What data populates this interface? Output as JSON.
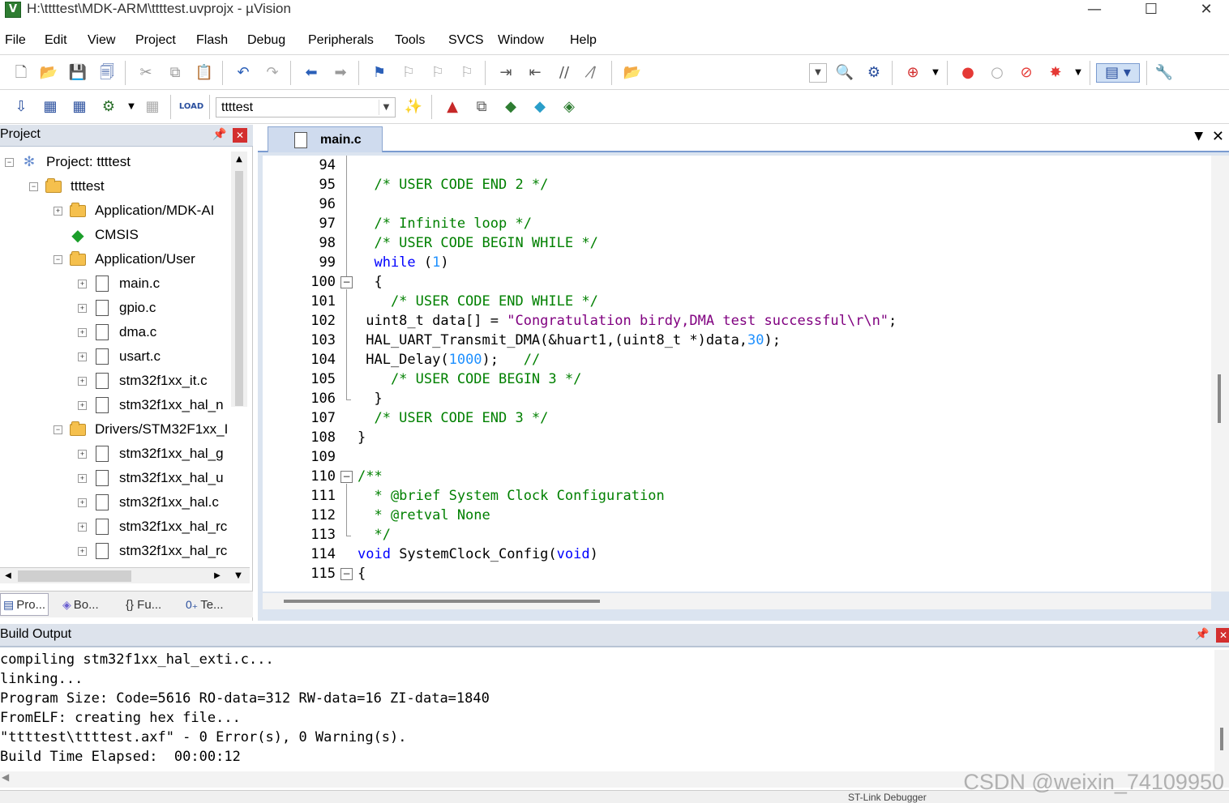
{
  "window": {
    "title": "H:\\ttttest\\MDK-ARM\\ttttest.uvprojx - µVision",
    "minimize": "—",
    "maximize": "☐",
    "close": "✕"
  },
  "menu": [
    "File",
    "Edit",
    "View",
    "Project",
    "Flash",
    "Debug",
    "Peripherals",
    "Tools",
    "SVCS",
    "Window",
    "Help"
  ],
  "toolbar2": {
    "target_name": "ttttest"
  },
  "project_panel": {
    "title": "Project",
    "tree": [
      {
        "label": "Project: ttttest",
        "kind": "project",
        "toggle": "−"
      },
      {
        "label": "ttttest",
        "kind": "target",
        "toggle": "−"
      },
      {
        "label": "Application/MDK-AI",
        "kind": "folder",
        "toggle": "+"
      },
      {
        "label": "CMSIS",
        "kind": "cmsis",
        "toggle": ""
      },
      {
        "label": "Application/User",
        "kind": "folder-open",
        "toggle": "−"
      },
      {
        "label": "main.c",
        "kind": "file",
        "toggle": "+"
      },
      {
        "label": "gpio.c",
        "kind": "file",
        "toggle": "+"
      },
      {
        "label": "dma.c",
        "kind": "file",
        "toggle": "+"
      },
      {
        "label": "usart.c",
        "kind": "file",
        "toggle": "+"
      },
      {
        "label": "stm32f1xx_it.c",
        "kind": "file",
        "toggle": "+"
      },
      {
        "label": "stm32f1xx_hal_n",
        "kind": "file",
        "toggle": "+"
      },
      {
        "label": "Drivers/STM32F1xx_I",
        "kind": "folder-open",
        "toggle": "−"
      },
      {
        "label": "stm32f1xx_hal_g",
        "kind": "file",
        "toggle": "+"
      },
      {
        "label": "stm32f1xx_hal_u",
        "kind": "file",
        "toggle": "+"
      },
      {
        "label": "stm32f1xx_hal.c",
        "kind": "file",
        "toggle": "+"
      },
      {
        "label": "stm32f1xx_hal_rc",
        "kind": "file",
        "toggle": "+"
      },
      {
        "label": "stm32f1xx_hal_rc",
        "kind": "file",
        "toggle": "+"
      }
    ],
    "tabs": [
      {
        "label": "Pro...",
        "icon": "▤"
      },
      {
        "label": "Bo...",
        "icon": "◈"
      },
      {
        "label": "{} Fu...",
        "icon": ""
      },
      {
        "label": "Te...",
        "icon": "0₊"
      }
    ]
  },
  "editor": {
    "tab_label": "main.c",
    "lines": [
      {
        "n": "94",
        "parts": []
      },
      {
        "n": "95",
        "parts": [
          [
            "cm",
            "  /* USER CODE END 2 */"
          ]
        ]
      },
      {
        "n": "96",
        "parts": []
      },
      {
        "n": "97",
        "parts": [
          [
            "cm",
            "  /* Infinite loop */"
          ]
        ]
      },
      {
        "n": "98",
        "parts": [
          [
            "cm",
            "  /* USER CODE BEGIN WHILE */"
          ]
        ]
      },
      {
        "n": "99",
        "parts": [
          [
            "",
            "  "
          ],
          [
            "kw",
            "while"
          ],
          [
            "",
            " ("
          ],
          [
            "num",
            "1"
          ],
          [
            "",
            ")"
          ]
        ]
      },
      {
        "n": "100",
        "parts": [
          [
            "",
            "  {"
          ]
        ]
      },
      {
        "n": "101",
        "parts": [
          [
            "cm",
            "    /* USER CODE END WHILE */"
          ]
        ]
      },
      {
        "n": "102",
        "parts": [
          [
            "",
            " uint8_t data[] = "
          ],
          [
            "str",
            "\"Congratulation birdy,DMA test successful\\r\\n\""
          ],
          [
            "",
            ";"
          ]
        ]
      },
      {
        "n": "103",
        "parts": [
          [
            "",
            " HAL_UART_Transmit_DMA(&huart1,(uint8_t *)data,"
          ],
          [
            "num",
            "30"
          ],
          [
            "",
            ");"
          ]
        ]
      },
      {
        "n": "104",
        "parts": [
          [
            "",
            " HAL_Delay("
          ],
          [
            "num",
            "1000"
          ],
          [
            "",
            ");   "
          ],
          [
            "cm",
            "//"
          ]
        ]
      },
      {
        "n": "105",
        "parts": [
          [
            "cm",
            "    /* USER CODE BEGIN 3 */"
          ]
        ]
      },
      {
        "n": "106",
        "parts": [
          [
            "",
            "  }"
          ]
        ]
      },
      {
        "n": "107",
        "parts": [
          [
            "cm",
            "  /* USER CODE END 3 */"
          ]
        ]
      },
      {
        "n": "108",
        "parts": [
          [
            "",
            "}"
          ]
        ]
      },
      {
        "n": "109",
        "parts": []
      },
      {
        "n": "110",
        "parts": [
          [
            "cm",
            "/**"
          ]
        ]
      },
      {
        "n": "111",
        "parts": [
          [
            "cm",
            "  * @brief System Clock Configuration"
          ]
        ]
      },
      {
        "n": "112",
        "parts": [
          [
            "cm",
            "  * @retval None"
          ]
        ]
      },
      {
        "n": "113",
        "parts": [
          [
            "cm",
            "  */"
          ]
        ]
      },
      {
        "n": "114",
        "parts": [
          [
            "kw",
            "void"
          ],
          [
            "",
            " SystemClock_Config("
          ],
          [
            "kw",
            "void"
          ],
          [
            "",
            ")"
          ]
        ]
      },
      {
        "n": "115",
        "parts": [
          [
            "",
            "{"
          ]
        ]
      }
    ]
  },
  "build_output": {
    "title": "Build Output",
    "lines": [
      "compiling stm32f1xx_hal_exti.c...",
      "linking...",
      "Program Size: Code=5616 RO-data=312 RW-data=16 ZI-data=1840",
      "FromELF: creating hex file...",
      "\"ttttest\\ttttest.axf\" - 0 Error(s), 0 Warning(s).",
      "Build Time Elapsed:  00:00:12"
    ]
  },
  "status": {
    "debugger": "ST-Link Debugger"
  },
  "watermark": "CSDN @weixin_74109950"
}
